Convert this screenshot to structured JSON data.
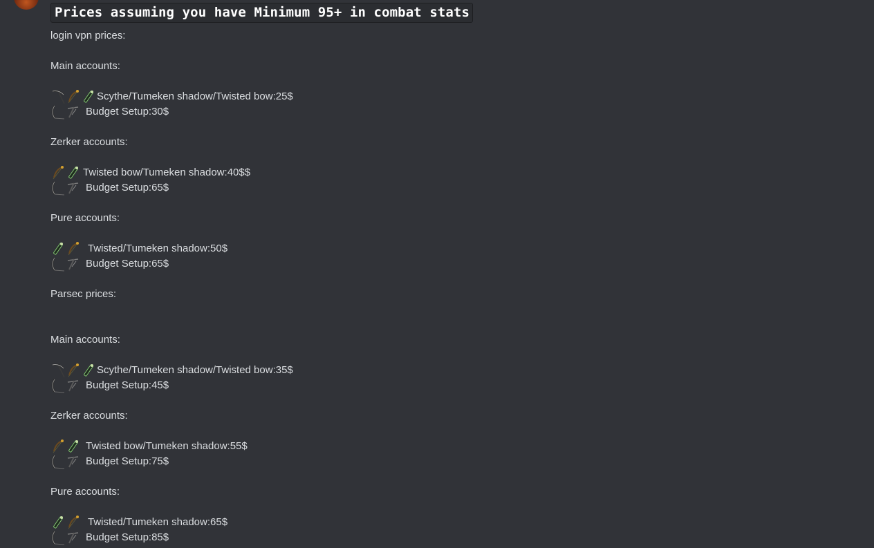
{
  "header": {
    "title": "Prices assuming you have Minimum 95+ in combat stats"
  },
  "sections": {
    "login_heading": "login vpn prices:",
    "login_main_heading": "Main accounts:",
    "login_main_row1": "Scythe/Tumeken shadow/Twisted bow:25$",
    "login_main_row2": "Budget Setup:30$",
    "login_zerker_heading": "Zerker accounts:",
    "login_zerker_row1": "Twisted bow/Tumeken shadow:40$$",
    "login_zerker_row2": "Budget Setup:65$",
    "login_pure_heading": "Pure accounts:",
    "login_pure_row1": "Twisted/Tumeken shadow:50$",
    "login_pure_row2": "Budget Setup:65$",
    "parsec_heading": "Parsec prices:",
    "parsec_main_heading": "Main accounts:",
    "parsec_main_row1": "Scythe/Tumeken shadow/Twisted bow:35$",
    "parsec_main_row2": "Budget Setup:45$",
    "parsec_zerker_heading": "Zerker accounts:",
    "parsec_zerker_row1": "Twisted bow/Tumeken shadow:55$",
    "parsec_zerker_row2": "Budget Setup:75$",
    "parsec_pure_heading": "Pure accounts:",
    "parsec_pure_row1": "Twisted/Tumeken shadow:65$",
    "parsec_pure_row2": "Budget Setup:85$"
  },
  "icons": {
    "scythe": "scythe-emoji-icon",
    "twisted_bow": "twisted-bow-emoji-icon",
    "tumeken_shadow": "tumeken-shadow-emoji-icon",
    "budget_bow": "budget-bow-emoji-icon",
    "budget_crossbow": "budget-crossbow-emoji-icon"
  },
  "colors": {
    "background": "#313338",
    "text": "#dbdee1",
    "code_background": "#2b2d31"
  }
}
